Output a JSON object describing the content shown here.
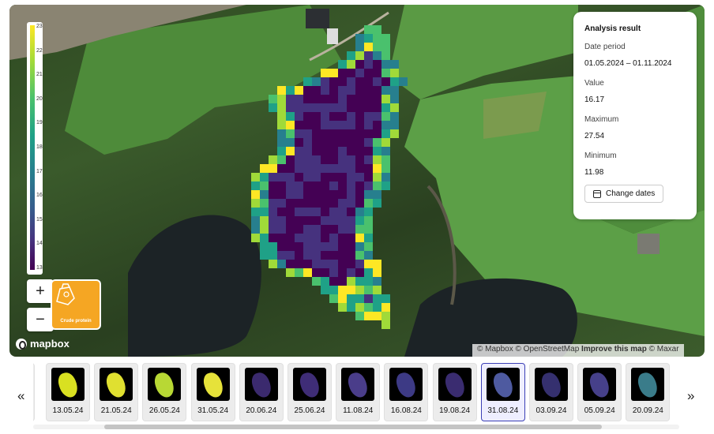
{
  "legend": {
    "ticks": [
      "23",
      "22",
      "21",
      "20",
      "19",
      "18",
      "17",
      "16",
      "15",
      "14",
      "13"
    ]
  },
  "map": {
    "zoom_in_label": "+",
    "zoom_out_label": "−",
    "layer_label": "Crude protein",
    "logo_text": "mapbox",
    "attribution": {
      "a": "© Mapbox",
      "b": "© OpenStreetMap",
      "c": "Improve this map",
      "d": "© Maxar"
    }
  },
  "panel": {
    "title": "Analysis result",
    "date_period_label": "Date period",
    "date_period_value": "01.05.2024 – 01.11.2024",
    "value_label": "Value",
    "value": "16.17",
    "max_label": "Maximum",
    "max_value": "27.54",
    "min_label": "Minimum",
    "min_value": "11.98",
    "change_dates_label": "Change dates"
  },
  "timeline": {
    "prev": "«",
    "next": "»",
    "dates": [
      "13.05.24",
      "21.05.24",
      "26.05.24",
      "31.05.24",
      "20.06.24",
      "25.06.24",
      "11.08.24",
      "16.08.24",
      "19.08.24",
      "31.08.24",
      "03.09.24",
      "05.09.24",
      "20.09.24"
    ],
    "selected_index": 9
  },
  "colors": {
    "accent": "#3b3fb6",
    "layer_button": "#f5a623"
  }
}
